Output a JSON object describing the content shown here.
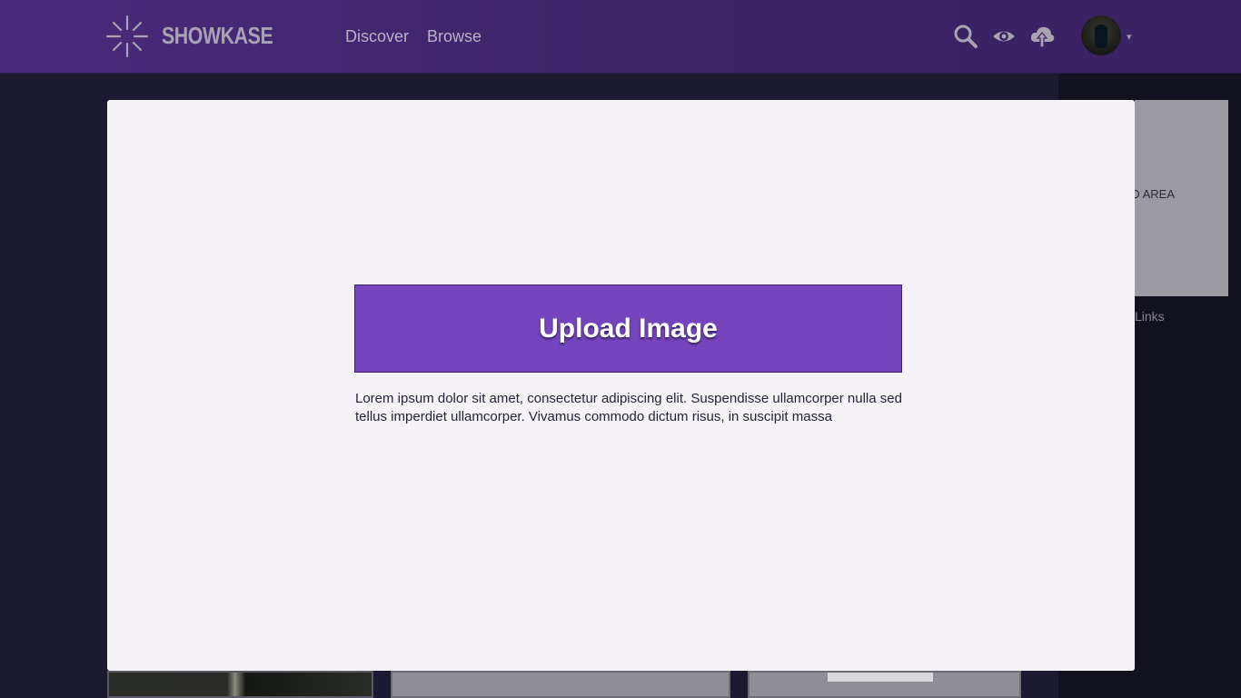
{
  "header": {
    "brand": "SHOWKASE",
    "nav": [
      {
        "label": "Discover"
      },
      {
        "label": "Browse"
      }
    ],
    "icons": [
      "search-icon",
      "eye-icon",
      "cloud-upload-icon"
    ],
    "caret": "▾"
  },
  "sidebar": {
    "ad_label": "AD AREA",
    "links_label": "Links"
  },
  "modal": {
    "upload_button_label": "Upload Image",
    "description": "Lorem ipsum dolor sit amet, consectetur adipiscing elit. Suspendisse ullamcorper nulla sed tellus imperdiet ullamcorper. Vivamus commodo dictum risus, in suscipit massa"
  },
  "colors": {
    "header_bg": "#3d2468",
    "accent": "#7445bd",
    "modal_bg": "#f5f3f7",
    "page_bg": "#161426"
  }
}
